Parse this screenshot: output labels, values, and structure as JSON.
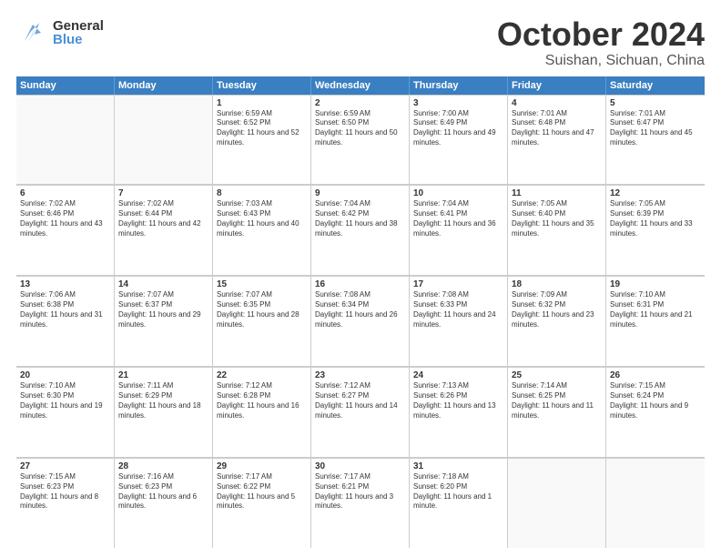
{
  "header": {
    "logo_general": "General",
    "logo_blue": "Blue",
    "month_title": "October 2024",
    "location": "Suishan, Sichuan, China"
  },
  "weekdays": [
    "Sunday",
    "Monday",
    "Tuesday",
    "Wednesday",
    "Thursday",
    "Friday",
    "Saturday"
  ],
  "weeks": [
    [
      {
        "day": "",
        "empty": true
      },
      {
        "day": "",
        "empty": true
      },
      {
        "day": "1",
        "sunrise": "6:59 AM",
        "sunset": "6:52 PM",
        "daylight": "11 hours and 52 minutes."
      },
      {
        "day": "2",
        "sunrise": "6:59 AM",
        "sunset": "6:50 PM",
        "daylight": "11 hours and 50 minutes."
      },
      {
        "day": "3",
        "sunrise": "7:00 AM",
        "sunset": "6:49 PM",
        "daylight": "11 hours and 49 minutes."
      },
      {
        "day": "4",
        "sunrise": "7:01 AM",
        "sunset": "6:48 PM",
        "daylight": "11 hours and 47 minutes."
      },
      {
        "day": "5",
        "sunrise": "7:01 AM",
        "sunset": "6:47 PM",
        "daylight": "11 hours and 45 minutes."
      }
    ],
    [
      {
        "day": "6",
        "sunrise": "7:02 AM",
        "sunset": "6:46 PM",
        "daylight": "11 hours and 43 minutes."
      },
      {
        "day": "7",
        "sunrise": "7:02 AM",
        "sunset": "6:44 PM",
        "daylight": "11 hours and 42 minutes."
      },
      {
        "day": "8",
        "sunrise": "7:03 AM",
        "sunset": "6:43 PM",
        "daylight": "11 hours and 40 minutes."
      },
      {
        "day": "9",
        "sunrise": "7:04 AM",
        "sunset": "6:42 PM",
        "daylight": "11 hours and 38 minutes."
      },
      {
        "day": "10",
        "sunrise": "7:04 AM",
        "sunset": "6:41 PM",
        "daylight": "11 hours and 36 minutes."
      },
      {
        "day": "11",
        "sunrise": "7:05 AM",
        "sunset": "6:40 PM",
        "daylight": "11 hours and 35 minutes."
      },
      {
        "day": "12",
        "sunrise": "7:05 AM",
        "sunset": "6:39 PM",
        "daylight": "11 hours and 33 minutes."
      }
    ],
    [
      {
        "day": "13",
        "sunrise": "7:06 AM",
        "sunset": "6:38 PM",
        "daylight": "11 hours and 31 minutes."
      },
      {
        "day": "14",
        "sunrise": "7:07 AM",
        "sunset": "6:37 PM",
        "daylight": "11 hours and 29 minutes."
      },
      {
        "day": "15",
        "sunrise": "7:07 AM",
        "sunset": "6:35 PM",
        "daylight": "11 hours and 28 minutes."
      },
      {
        "day": "16",
        "sunrise": "7:08 AM",
        "sunset": "6:34 PM",
        "daylight": "11 hours and 26 minutes."
      },
      {
        "day": "17",
        "sunrise": "7:08 AM",
        "sunset": "6:33 PM",
        "daylight": "11 hours and 24 minutes."
      },
      {
        "day": "18",
        "sunrise": "7:09 AM",
        "sunset": "6:32 PM",
        "daylight": "11 hours and 23 minutes."
      },
      {
        "day": "19",
        "sunrise": "7:10 AM",
        "sunset": "6:31 PM",
        "daylight": "11 hours and 21 minutes."
      }
    ],
    [
      {
        "day": "20",
        "sunrise": "7:10 AM",
        "sunset": "6:30 PM",
        "daylight": "11 hours and 19 minutes."
      },
      {
        "day": "21",
        "sunrise": "7:11 AM",
        "sunset": "6:29 PM",
        "daylight": "11 hours and 18 minutes."
      },
      {
        "day": "22",
        "sunrise": "7:12 AM",
        "sunset": "6:28 PM",
        "daylight": "11 hours and 16 minutes."
      },
      {
        "day": "23",
        "sunrise": "7:12 AM",
        "sunset": "6:27 PM",
        "daylight": "11 hours and 14 minutes."
      },
      {
        "day": "24",
        "sunrise": "7:13 AM",
        "sunset": "6:26 PM",
        "daylight": "11 hours and 13 minutes."
      },
      {
        "day": "25",
        "sunrise": "7:14 AM",
        "sunset": "6:25 PM",
        "daylight": "11 hours and 11 minutes."
      },
      {
        "day": "26",
        "sunrise": "7:15 AM",
        "sunset": "6:24 PM",
        "daylight": "11 hours and 9 minutes."
      }
    ],
    [
      {
        "day": "27",
        "sunrise": "7:15 AM",
        "sunset": "6:23 PM",
        "daylight": "11 hours and 8 minutes."
      },
      {
        "day": "28",
        "sunrise": "7:16 AM",
        "sunset": "6:23 PM",
        "daylight": "11 hours and 6 minutes."
      },
      {
        "day": "29",
        "sunrise": "7:17 AM",
        "sunset": "6:22 PM",
        "daylight": "11 hours and 5 minutes."
      },
      {
        "day": "30",
        "sunrise": "7:17 AM",
        "sunset": "6:21 PM",
        "daylight": "11 hours and 3 minutes."
      },
      {
        "day": "31",
        "sunrise": "7:18 AM",
        "sunset": "6:20 PM",
        "daylight": "11 hours and 1 minute."
      },
      {
        "day": "",
        "empty": true
      },
      {
        "day": "",
        "empty": true
      }
    ]
  ]
}
